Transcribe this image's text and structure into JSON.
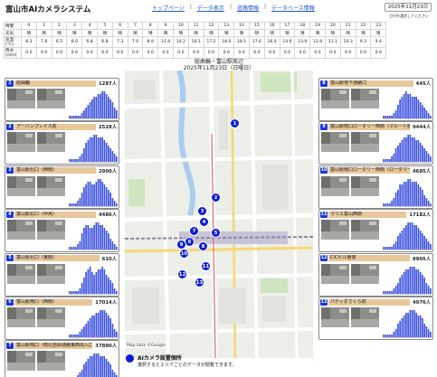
{
  "header": {
    "title": "富山市AIカメラシステム",
    "nav": [
      "トップページ",
      "データ表示",
      "道路情報",
      "データベース情報"
    ],
    "date": "2025年11月23日",
    "date_note": "日付を選択してください"
  },
  "weather": {
    "hours_label": "時間",
    "hours": [
      "0",
      "1",
      "2",
      "3",
      "4",
      "5",
      "6",
      "7",
      "8",
      "9",
      "10",
      "11",
      "12",
      "13",
      "14",
      "15",
      "16",
      "17",
      "18",
      "19",
      "20",
      "21",
      "22",
      "23"
    ],
    "condition_label": "天気",
    "conditions": [
      "晴",
      "晴",
      "晴",
      "晴",
      "晴",
      "晴",
      "晴",
      "晴",
      "晴",
      "晴",
      "晴",
      "晴",
      "晴",
      "晴",
      "晴",
      "晴",
      "晴",
      "晴",
      "晴",
      "晴",
      "晴",
      "晴",
      "晴",
      "晴"
    ],
    "temp_label": "気温(℃)",
    "temps": [
      "8.3",
      "7.8",
      "6.5",
      "6.0",
      "6.8",
      "6.8",
      "7.3",
      "7.6",
      "8.9",
      "11.8",
      "14.2",
      "16.1",
      "17.2",
      "18.0",
      "18.1",
      "17.6",
      "16.4",
      "14.6",
      "13.9",
      "12.8",
      "11.1",
      "10.3",
      "9.3",
      "9.4"
    ],
    "rain_label": "降水(mm)",
    "rain": [
      "0.0",
      "0.0",
      "0.0",
      "0.0",
      "0.0",
      "0.0",
      "0.0",
      "0.0",
      "0.0",
      "0.0",
      "0.0",
      "0.0",
      "0.0",
      "0.0",
      "0.0",
      "0.0",
      "0.0",
      "0.0",
      "0.0",
      "0.0",
      "0.0",
      "0.0",
      "0.0",
      "0.0"
    ]
  },
  "map": {
    "title": "総曲輪・富山駅周辺",
    "date": "2025年11月23日（日曜日）",
    "credit": "Map data ©Google",
    "legend_label": "AIカメラ設置個所",
    "legend_note": "選択するとエリアごとのデータが閲覧できます。",
    "markers": [
      "1",
      "2",
      "3",
      "4",
      "5",
      "6",
      "7",
      "8",
      "9",
      "10",
      "11",
      "12",
      "13"
    ]
  },
  "left_cards": [
    {
      "num": "1",
      "name": "総曲輪",
      "count": "1287人",
      "values": [
        1,
        1,
        1,
        1,
        1,
        1,
        2,
        3,
        4,
        5,
        6,
        7,
        8,
        8,
        9,
        9,
        10,
        10,
        9,
        8,
        7,
        6,
        4,
        3
      ]
    },
    {
      "num": "2",
      "name": "アーバンプレイス前",
      "count": "2528人",
      "values": [
        1,
        1,
        1,
        1,
        1,
        2,
        3,
        5,
        7,
        8,
        9,
        9,
        10,
        10,
        9,
        9,
        9,
        8,
        7,
        6,
        5,
        4,
        3,
        2
      ]
    },
    {
      "num": "3",
      "name": "富山駅北口（西側）",
      "count": "2900人",
      "values": [
        1,
        1,
        1,
        1,
        2,
        3,
        5,
        7,
        8,
        9,
        9,
        8,
        8,
        9,
        10,
        10,
        9,
        8,
        7,
        6,
        5,
        3,
        2,
        1
      ]
    },
    {
      "num": "4",
      "name": "富山駅北口（中央）",
      "count": "4486人",
      "values": [
        1,
        1,
        1,
        1,
        2,
        3,
        6,
        8,
        9,
        9,
        8,
        8,
        9,
        10,
        10,
        9,
        9,
        8,
        7,
        6,
        4,
        3,
        2,
        1
      ]
    },
    {
      "num": "5",
      "name": "富山駅北口（東側）",
      "count": "610人",
      "values": [
        1,
        1,
        1,
        1,
        1,
        2,
        4,
        6,
        8,
        9,
        10,
        8,
        7,
        8,
        9,
        9,
        10,
        9,
        7,
        6,
        5,
        4,
        2,
        1
      ]
    },
    {
      "num": "6",
      "name": "富山駅南口（西側）",
      "count": "17014人",
      "values": [
        1,
        1,
        1,
        1,
        1,
        2,
        3,
        4,
        5,
        6,
        7,
        8,
        8,
        9,
        9,
        10,
        10,
        10,
        9,
        8,
        7,
        5,
        3,
        2
      ]
    },
    {
      "num": "7",
      "name": "富山駅南口（南北自由通路東西出入口エリア）",
      "count": "37890人",
      "values": [
        1,
        1,
        1,
        1,
        2,
        3,
        4,
        6,
        7,
        8,
        9,
        9,
        10,
        10,
        10,
        9,
        9,
        9,
        8,
        7,
        6,
        4,
        3,
        2
      ]
    }
  ],
  "right_cards": [
    {
      "num": "8",
      "name": "富山駅地下通路口",
      "count": "445人",
      "values": [
        1,
        1,
        1,
        1,
        1,
        2,
        3,
        5,
        7,
        8,
        9,
        10,
        9,
        9,
        8,
        8,
        8,
        7,
        6,
        5,
        4,
        3,
        2,
        1
      ]
    },
    {
      "num": "9",
      "name": "富山駅南口ロータリー西側（マルート側）",
      "count": "9444人",
      "values": [
        1,
        1,
        1,
        1,
        2,
        3,
        5,
        6,
        7,
        8,
        9,
        9,
        10,
        10,
        9,
        9,
        8,
        8,
        7,
        6,
        5,
        4,
        3,
        2
      ]
    },
    {
      "num": "10",
      "name": "富山駅南口ロータリー西側（ロータリー側）",
      "count": "4685人",
      "values": [
        1,
        1,
        1,
        1,
        2,
        3,
        5,
        6,
        8,
        8,
        9,
        9,
        10,
        10,
        9,
        9,
        9,
        8,
        7,
        6,
        4,
        3,
        2,
        1
      ]
    },
    {
      "num": "11",
      "name": "マリエ富山西側",
      "count": "17182人",
      "values": [
        1,
        1,
        1,
        1,
        1,
        2,
        3,
        5,
        6,
        7,
        8,
        9,
        10,
        10,
        10,
        9,
        9,
        8,
        7,
        6,
        5,
        4,
        3,
        2
      ]
    },
    {
      "num": "12",
      "name": "CiCビル東側",
      "count": "8905人",
      "values": [
        1,
        1,
        1,
        1,
        1,
        2,
        3,
        4,
        6,
        7,
        8,
        9,
        9,
        10,
        10,
        10,
        9,
        9,
        8,
        7,
        6,
        4,
        3,
        2
      ]
    },
    {
      "num": "13",
      "name": "パティオさくら前",
      "count": "4976人",
      "values": [
        1,
        1,
        1,
        1,
        1,
        2,
        3,
        5,
        6,
        7,
        8,
        9,
        9,
        10,
        10,
        10,
        9,
        8,
        8,
        7,
        5,
        4,
        3,
        2
      ]
    }
  ],
  "colors": {
    "accent": "#0a1bd6",
    "card_label": "#e8c79a",
    "bar": "#3a4fe0",
    "link": "#1a56c7"
  }
}
